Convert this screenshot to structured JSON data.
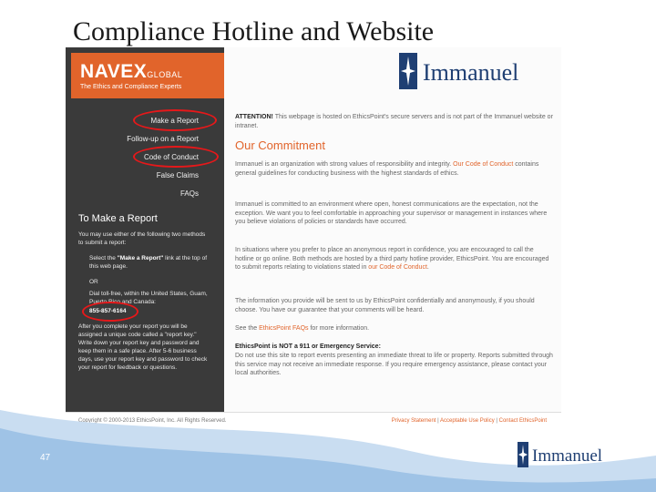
{
  "slide": {
    "title": "Compliance Hotline and Website",
    "page_number": "47"
  },
  "brand": {
    "name": "Immanuel"
  },
  "vendor": {
    "name": "NAVEX",
    "name_suffix": "GLOBAL",
    "tagline": "The Ethics and Compliance Experts"
  },
  "nav": {
    "items": [
      "Make a Report",
      "Follow-up on a Report",
      "Code of Conduct",
      "False Claims",
      "FAQs"
    ]
  },
  "sidebar": {
    "section_title": "To Make a Report",
    "intro": "You may use either of the following two methods to submit a report:",
    "method1_pre": "Select the ",
    "method1_bold": "\"Make a Report\"",
    "method1_post": " link at the top of this web page.",
    "or": "OR",
    "method2": "Dial toll-free, within the United States, Guam, Puerto Rico and Canada:",
    "phone": "855-857-6164",
    "after": "After you complete your report you will be assigned a unique code called a \"report key.\" Write down your report key and password and keep them in a safe place. After 5-6 business days, use your report key and password to check your report for feedback or questions."
  },
  "main": {
    "attention_bold": "ATTENTION!",
    "attention_text": " This webpage is hosted on EthicsPoint's secure servers and is not part of the Immanuel website or intranet.",
    "commitment_heading": "Our Commitment",
    "p1_pre": "Immanuel is an organization with strong values of responsibility and integrity. ",
    "p1_link": "Our Code of Conduct",
    "p1_post": " contains general guidelines for conducting business with the highest standards of ethics.",
    "p2": "Immanuel is committed to an environment where open, honest communications are the expectation, not the exception. We want you to feel comfortable in approaching your supervisor or management in instances where you believe violations of policies or standards have occurred.",
    "p3_pre": "In situations where you prefer to place an anonymous report in confidence, you are encouraged to call the hotline or go online. Both methods are hosted by a third party hotline provider, EthicsPoint. You are encouraged to submit reports relating to violations stated in ",
    "p3_link": "our Code of Conduct",
    "p3_post": ".",
    "p4": "The information you provide will be sent to us by EthicsPoint confidentially and anonymously, if you should choose. You have our guarantee that your comments will be heard.",
    "p5_pre": "See the ",
    "p5_link": "EthicsPoint FAQs",
    "p5_post": " for more information.",
    "emergency_title": "EthicsPoint is NOT a 911 or Emergency Service:",
    "emergency_text": "Do not use this site to report events presenting an immediate threat to life or property. Reports submitted through this service may not receive an immediate response. If you require emergency assistance, please contact your local authorities."
  },
  "footer": {
    "copyright": "Copyright © 2000-2013 EthicsPoint, Inc. All Rights Reserved.",
    "privacy": "Privacy Statement",
    "aup": "Acceptable Use Policy",
    "contact": "Contact EthicsPoint",
    "sep": " | "
  },
  "colors": {
    "navex_orange": "#e1642b",
    "sidebar_dark": "#3a3a3a",
    "highlight_circle": "#e6181a",
    "brand_navy": "#1f3f73",
    "wave_blue": "#9fc3e6"
  }
}
